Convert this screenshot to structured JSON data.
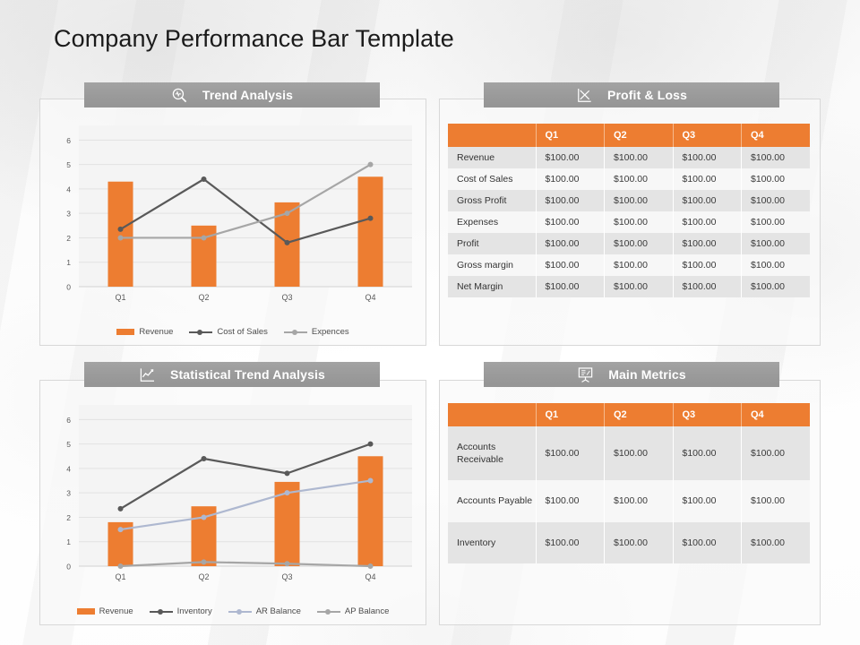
{
  "page_title": "Company Performance Bar Template",
  "colors": {
    "orange": "#ED7D31",
    "header_gray": "#9a9a9a",
    "dark_line": "#595959",
    "light_line": "#A6A6A6",
    "blue_gray_line": "#AEB8D0",
    "plot_bg": "#f4f4f4"
  },
  "panels": {
    "trend": {
      "title": "Trend Analysis",
      "icon": "magnifier-pulse-icon"
    },
    "profit_loss": {
      "title": "Profit & Loss",
      "icon": "line-chart-axis-icon"
    },
    "statistical": {
      "title": "Statistical Trend Analysis",
      "icon": "rising-line-chart-icon"
    },
    "main_metrics": {
      "title": "Main Metrics",
      "icon": "presentation-board-icon"
    }
  },
  "chart_data": [
    {
      "id": "trend-analysis",
      "type": "bar",
      "title": "Trend Analysis",
      "categories": [
        "Q1",
        "Q2",
        "Q3",
        "Q4"
      ],
      "xlabel": "",
      "ylabel": "",
      "ylim": [
        0,
        6.6
      ],
      "yticks": [
        0,
        1,
        2,
        3,
        4,
        5,
        6
      ],
      "grid": true,
      "legend_position": "bottom",
      "series": [
        {
          "name": "Revenue",
          "kind": "bar",
          "color": "#ED7D31",
          "values": [
            4.3,
            2.5,
            3.45,
            4.5
          ]
        },
        {
          "name": "Cost of Sales",
          "kind": "line",
          "color": "#595959",
          "values": [
            2.35,
            4.4,
            1.8,
            2.8
          ]
        },
        {
          "name": "Expences",
          "kind": "line",
          "color": "#A6A6A6",
          "values": [
            2.0,
            2.0,
            3.0,
            5.0
          ]
        }
      ]
    },
    {
      "id": "statistical-trend-analysis",
      "type": "bar",
      "title": "Statistical Trend Analysis",
      "categories": [
        "Q1",
        "Q2",
        "Q3",
        "Q4"
      ],
      "xlabel": "",
      "ylabel": "",
      "ylim": [
        0,
        6.6
      ],
      "yticks": [
        0,
        1,
        2,
        3,
        4,
        5,
        6
      ],
      "grid": true,
      "legend_position": "bottom",
      "series": [
        {
          "name": "Revenue",
          "kind": "bar",
          "color": "#ED7D31",
          "values": [
            1.8,
            2.45,
            3.45,
            4.5
          ]
        },
        {
          "name": "Inventory",
          "kind": "line",
          "color": "#595959",
          "values": [
            2.35,
            4.4,
            3.8,
            5.0
          ]
        },
        {
          "name": "AR Balance",
          "kind": "line",
          "color": "#AEB8D0",
          "values": [
            1.5,
            2.0,
            3.0,
            3.5
          ]
        },
        {
          "name": "AP Balance",
          "kind": "line",
          "color": "#A6A6A6",
          "values": [
            0.0,
            0.17,
            0.1,
            0.0
          ]
        }
      ]
    }
  ],
  "tables": {
    "profit_loss": {
      "columns": [
        "",
        "Q1",
        "Q2",
        "Q3",
        "Q4"
      ],
      "rows": [
        {
          "label": "Revenue",
          "values": [
            "$100.00",
            "$100.00",
            "$100.00",
            "$100.00"
          ]
        },
        {
          "label": "Cost of Sales",
          "values": [
            "$100.00",
            "$100.00",
            "$100.00",
            "$100.00"
          ]
        },
        {
          "label": "Gross Profit",
          "values": [
            "$100.00",
            "$100.00",
            "$100.00",
            "$100.00"
          ]
        },
        {
          "label": "Expenses",
          "values": [
            "$100.00",
            "$100.00",
            "$100.00",
            "$100.00"
          ]
        },
        {
          "label": "Profit",
          "values": [
            "$100.00",
            "$100.00",
            "$100.00",
            "$100.00"
          ]
        },
        {
          "label": "Gross margin",
          "values": [
            "$100.00",
            "$100.00",
            "$100.00",
            "$100.00"
          ]
        },
        {
          "label": "Net Margin",
          "values": [
            "$100.00",
            "$100.00",
            "$100.00",
            "$100.00"
          ]
        }
      ]
    },
    "main_metrics": {
      "columns": [
        "",
        "Q1",
        "Q2",
        "Q3",
        "Q4"
      ],
      "rows": [
        {
          "label": "Accounts Receivable",
          "values": [
            "$100.00",
            "$100.00",
            "$100.00",
            "$100.00"
          ]
        },
        {
          "label": "Accounts Payable",
          "values": [
            "$100.00",
            "$100.00",
            "$100.00",
            "$100.00"
          ]
        },
        {
          "label": "Inventory",
          "values": [
            "$100.00",
            "$100.00",
            "$100.00",
            "$100.00"
          ]
        }
      ]
    }
  }
}
